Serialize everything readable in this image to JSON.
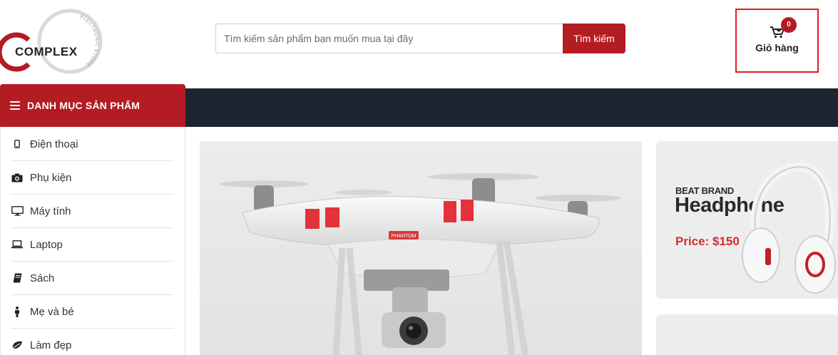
{
  "header": {
    "logo": {
      "word": "COMPLEX",
      "ring_text": "ELECTRONIC STORE"
    },
    "search": {
      "placeholder": "Tìm kiếm sản phẩm bạn muốn mua tại đây",
      "value": "",
      "button_label": "Tìm kiếm"
    },
    "cart": {
      "count": "0",
      "label": "Giỏ hàng"
    }
  },
  "categories": {
    "title": "DANH MỤC SẢN PHẨM",
    "items": [
      {
        "label": "Điện thoại",
        "icon": "mobile-phone-icon"
      },
      {
        "label": "Phụ kiện",
        "icon": "camera-icon"
      },
      {
        "label": "Máy tính",
        "icon": "desktop-monitor-icon"
      },
      {
        "label": "Laptop",
        "icon": "laptop-icon"
      },
      {
        "label": "Sách",
        "icon": "book-icon"
      },
      {
        "label": "Mẹ và bé",
        "icon": "child-icon"
      },
      {
        "label": "Làm đẹp",
        "icon": "leaf-icon"
      }
    ]
  },
  "banners": {
    "main": {
      "product": "drone",
      "printed_text": "PHANTOM"
    },
    "side": {
      "brand": "BEAT BRAND",
      "title": "Headphone",
      "price": "Price: $150"
    }
  },
  "colors": {
    "primary": "#b31c22",
    "navbar": "#1d2630",
    "cart_highlight": "#e21b23",
    "price": "#d22d2d"
  }
}
